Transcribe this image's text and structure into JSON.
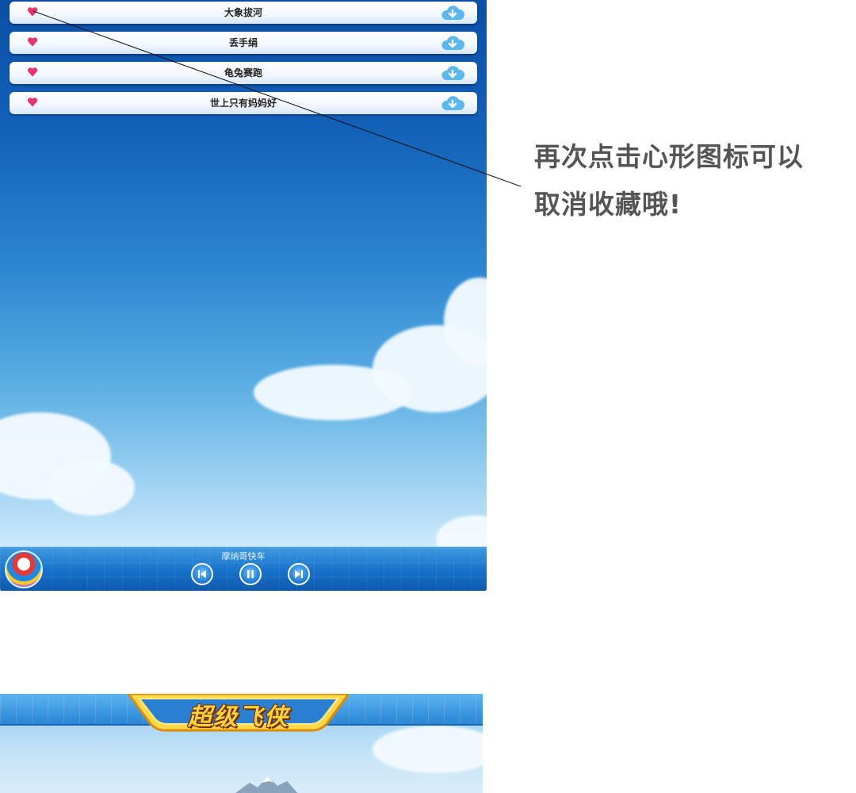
{
  "playlist": {
    "songs": [
      {
        "title": "大象拔河",
        "favorited": true
      },
      {
        "title": "丢手绢",
        "favorited": true
      },
      {
        "title": "龟兔赛跑",
        "favorited": true
      },
      {
        "title": "世上只有妈妈好",
        "favorited": true
      }
    ],
    "icons": {
      "favorite": "heart-icon",
      "download": "cloud-download-icon"
    },
    "colors": {
      "heart": "#e9336d",
      "download": "#5ab8ee"
    }
  },
  "player": {
    "now_playing": "摩纳哥快车",
    "controls": [
      "previous",
      "pause",
      "next"
    ]
  },
  "annotation": {
    "line1": "再次点击心形图标可以",
    "line2": "取消收藏哦!"
  },
  "bottom_screen": {
    "logo_text": "超级飞侠"
  }
}
